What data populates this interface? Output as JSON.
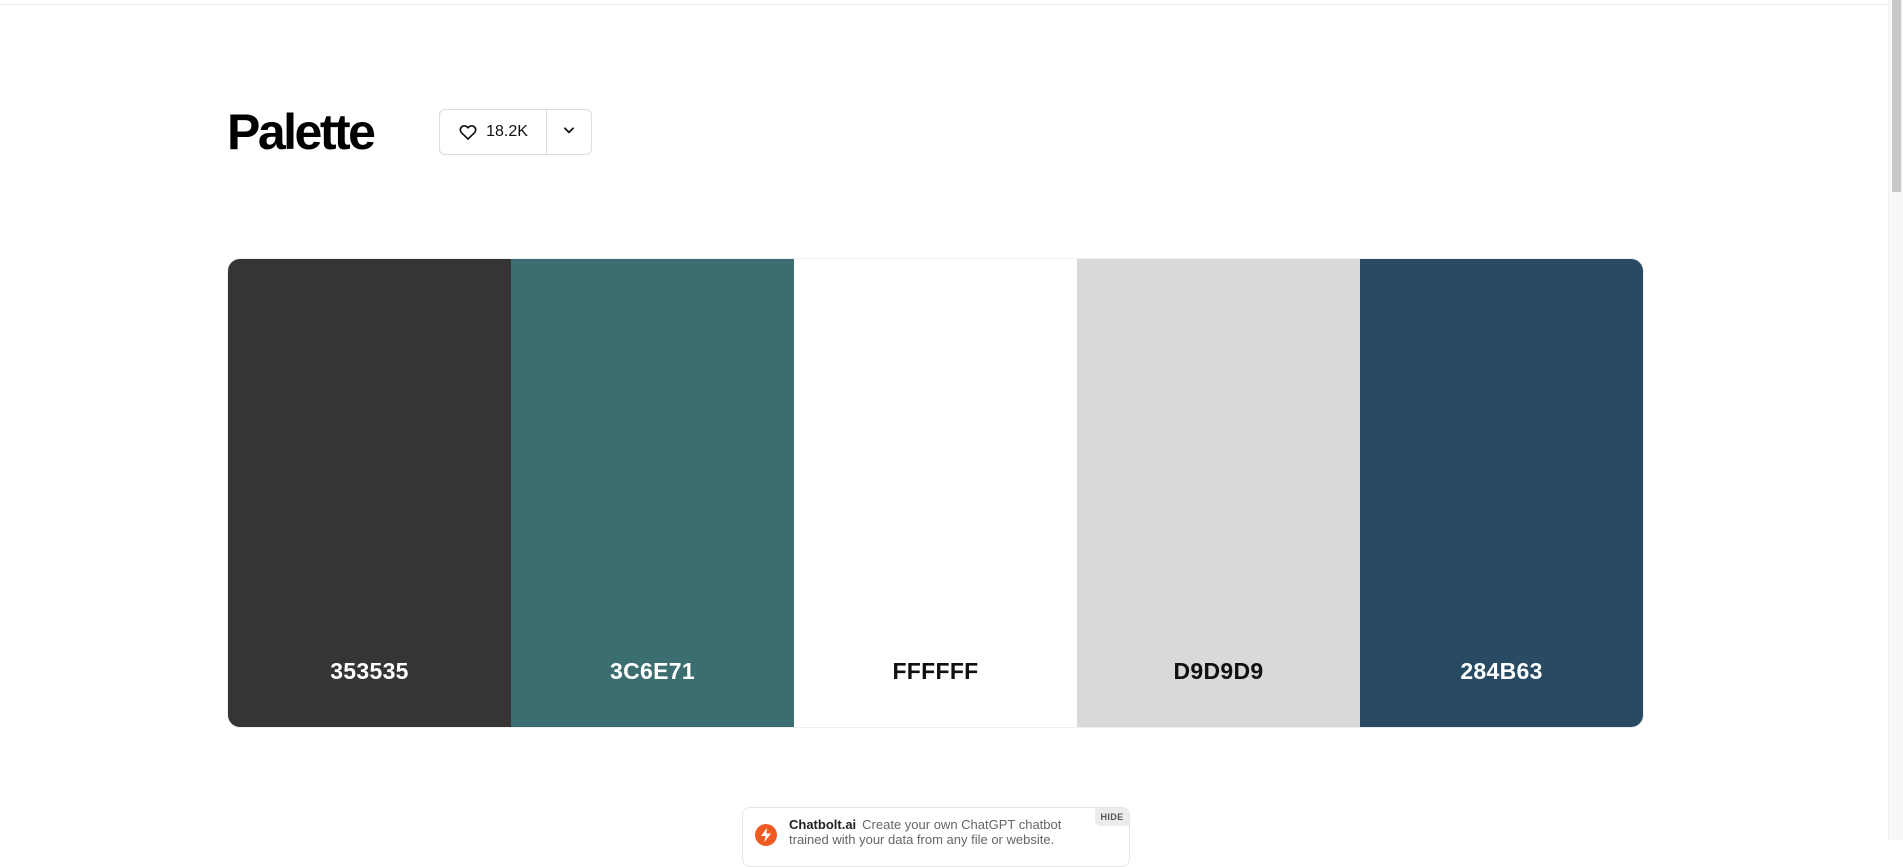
{
  "page": {
    "title": "Palette"
  },
  "likes": {
    "count": "18.2K",
    "icon": "heart-icon",
    "dropdown_icon": "chevron-down-icon"
  },
  "palette": {
    "colors": [
      {
        "hex": "353535",
        "color": "#353535",
        "text_color": "#ffffff"
      },
      {
        "hex": "3C6E71",
        "color": "#3C6E71",
        "text_color": "#ffffff"
      },
      {
        "hex": "FFFFFF",
        "color": "#FFFFFF",
        "text_color": "#111111"
      },
      {
        "hex": "D9D9D9",
        "color": "#D9D9D9",
        "text_color": "#111111"
      },
      {
        "hex": "284B63",
        "color": "#284B63",
        "text_color": "#ffffff"
      }
    ]
  },
  "ad": {
    "brand": "Chatbolt.ai",
    "text": "Create your own ChatGPT chatbot trained with your data from any file or website.",
    "hide_label": "HIDE",
    "logo_color": "#f05a22"
  }
}
